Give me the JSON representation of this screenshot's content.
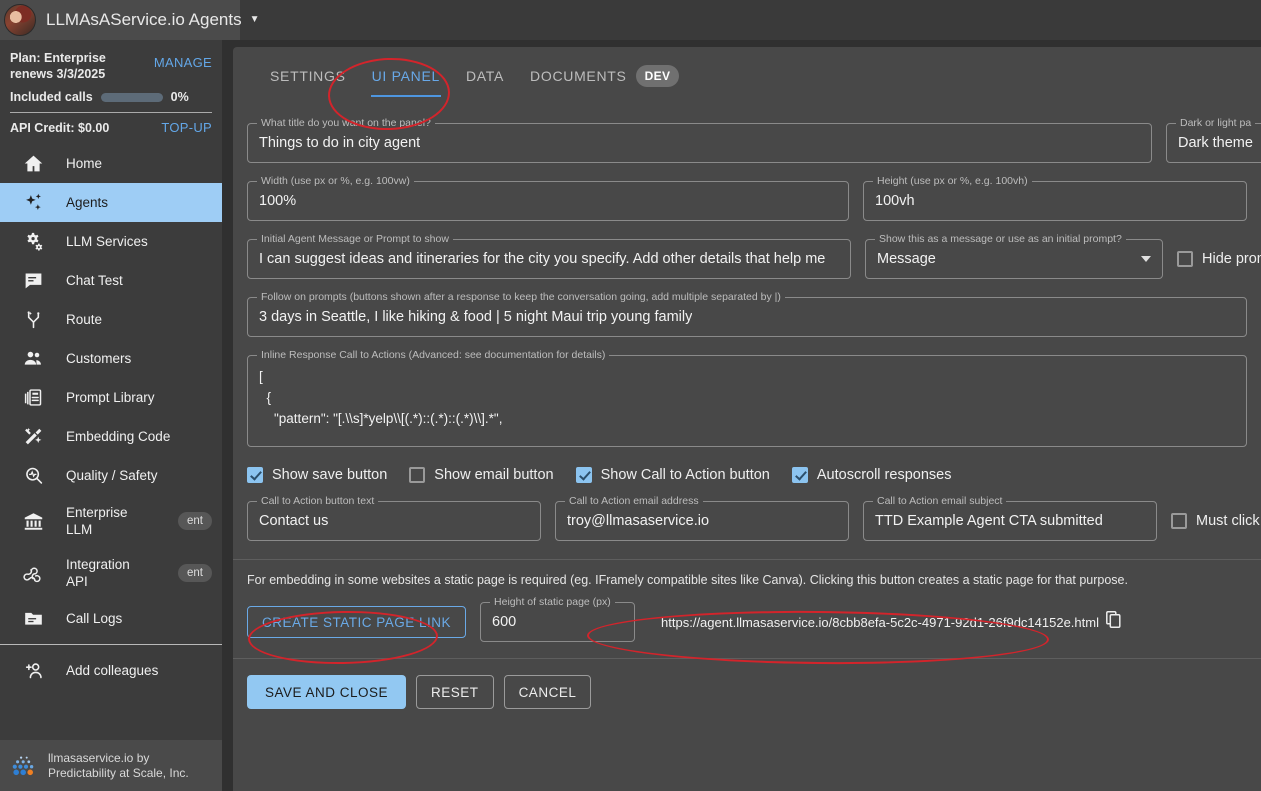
{
  "appbar": {
    "title": "LLMAsAService.io Agents",
    "caret": "▼",
    "avatar_name": "user-avatar"
  },
  "sidebar": {
    "plan": {
      "plan_line1": "Plan: Enterprise",
      "plan_line2": "renews 3/3/2025",
      "manage_label": "MANAGE",
      "calls_label": "Included calls",
      "calls_percent": "0%",
      "calls_fill": 0,
      "credit_label": "API Credit: $0.00",
      "topup_label": "TOP-UP"
    },
    "items": [
      {
        "label": "Home",
        "icon": "home-icon",
        "active": false,
        "badge": ""
      },
      {
        "label": "Agents",
        "icon": "sparkles-icon",
        "active": true,
        "badge": ""
      },
      {
        "label": "LLM Services",
        "icon": "gears-icon",
        "active": false,
        "badge": ""
      },
      {
        "label": "Chat Test",
        "icon": "chat-bubble-icon",
        "active": false,
        "badge": ""
      },
      {
        "label": "Route",
        "icon": "route-icon",
        "active": false,
        "badge": ""
      },
      {
        "label": "Customers",
        "icon": "people-icon",
        "active": false,
        "badge": ""
      },
      {
        "label": "Prompt Library",
        "icon": "library-icon",
        "active": false,
        "badge": ""
      },
      {
        "label": "Embedding Code",
        "icon": "tools-icon",
        "active": false,
        "badge": ""
      },
      {
        "label": "Quality / Safety",
        "icon": "magnifier-pulse-icon",
        "active": false,
        "badge": ""
      },
      {
        "label": "Enterprise\nLLM",
        "icon": "bank-icon",
        "active": false,
        "badge": "ent"
      },
      {
        "label": "Integration\nAPI",
        "icon": "webhook-icon",
        "active": false,
        "badge": "ent"
      },
      {
        "label": "Call Logs",
        "icon": "folder-icon",
        "active": false,
        "badge": ""
      },
      {
        "label": "Add colleagues",
        "icon": "add-person-icon",
        "active": false,
        "badge": ""
      }
    ],
    "footer": {
      "line1": "llmasaservice.io by",
      "line2": "Predictability at Scale, Inc."
    }
  },
  "main": {
    "tabs": [
      {
        "label": "SETTINGS",
        "active": false,
        "badge": ""
      },
      {
        "label": "UI PANEL",
        "active": true,
        "badge": ""
      },
      {
        "label": "DATA",
        "active": false,
        "badge": ""
      },
      {
        "label": "DOCUMENTS",
        "active": false,
        "badge": "DEV"
      }
    ],
    "fields": {
      "title": {
        "label": "What title do you want on the panel?",
        "value": "Things to do in city agent"
      },
      "theme": {
        "label": "Dark or light pa",
        "value": "Dark theme"
      },
      "width": {
        "label": "Width (use px or %, e.g. 100vw)",
        "value": "100%"
      },
      "height": {
        "label": "Height (use px or %, e.g. 100vh)",
        "value": "100vh"
      },
      "initial_message": {
        "label": "Initial Agent Message or Prompt to show",
        "value": "I can suggest ideas and itineraries for the city you specify. Add other details that help me"
      },
      "message_mode": {
        "label": "Show this as a message or use as an initial prompt?",
        "value": "Message"
      },
      "hide_prompt": {
        "label": "Hide prom",
        "checked": false
      },
      "follow_on": {
        "label": "Follow on prompts (buttons shown after a response to keep the conversation going, add multiple separated by |)",
        "value": "3 days in Seattle, I like hiking & food | 5 night Maui trip young family"
      },
      "inline_cta": {
        "label": "Inline Response Call to Actions (Advanced: see documentation for details)",
        "value": "[\n  {\n    \"pattern\": \"[.\\\\s]*yelp\\\\[(.*)::(.*)::(.*)\\\\].*\","
      },
      "cta_button_text": {
        "label": "Call to Action button text",
        "value": "Contact us"
      },
      "cta_email": {
        "label": "Call to Action email address",
        "value": "troy@llmasaservice.io"
      },
      "cta_subject": {
        "label": "Call to Action email subject",
        "value": "TTD Example Agent CTA submitted"
      },
      "must_click": {
        "label": "Must click",
        "checked": false
      },
      "static_height": {
        "label": "Height of static page (px)",
        "value": "600"
      }
    },
    "checkboxes": [
      {
        "label": "Show save button",
        "checked": true
      },
      {
        "label": "Show email button",
        "checked": false
      },
      {
        "label": "Show Call to Action button",
        "checked": true
      },
      {
        "label": "Autoscroll responses",
        "checked": true
      }
    ],
    "static_section": {
      "help": "For embedding in some websites a static page is required (eg. IFramely compatible sites like Canva). Clicking this button creates a static page for that purpose.",
      "create_button": "CREATE STATIC PAGE LINK",
      "url": "https://agent.llmasaservice.io/8cbb8efa-5c2c-4971-92d1-26f9dc14152e.html",
      "copy_icon": "copy-icon"
    },
    "actions": {
      "save": "SAVE AND CLOSE",
      "reset": "RESET",
      "cancel": "CANCEL"
    }
  },
  "colors": {
    "accent_blue": "#68a8e8",
    "primary_button": "#92c8f2",
    "active_nav": "#9ecdf5",
    "annotation_red": "#d3242b",
    "panel_bg": "#484848",
    "sidebar_bg": "#3c3c3c"
  }
}
